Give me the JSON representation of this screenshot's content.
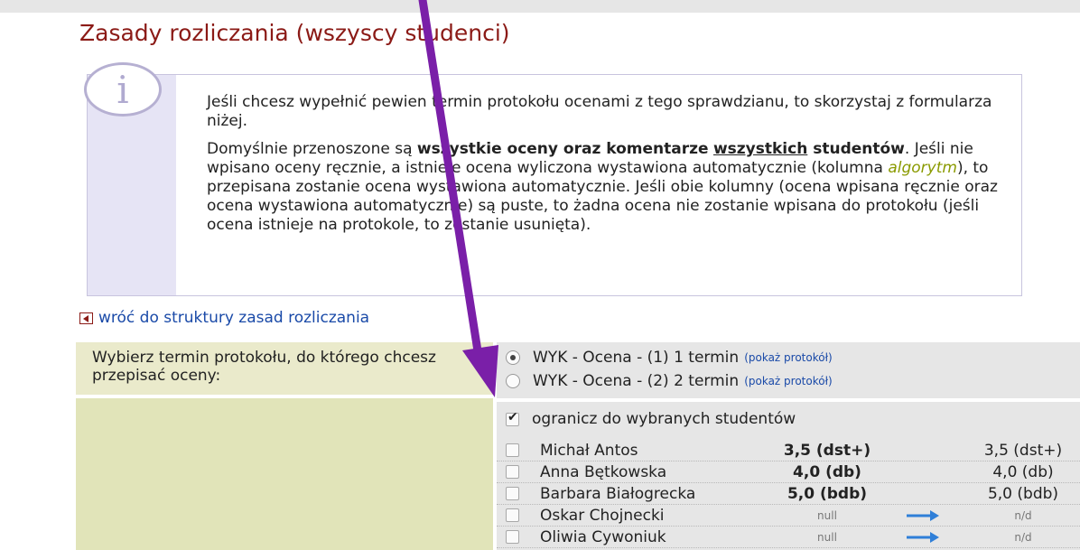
{
  "page": {
    "title": "Zasady rozliczania (wszyscy studenci)",
    "back_link": "wróć do struktury zasad rozliczania"
  },
  "info": {
    "icon": "info-icon",
    "p1": "Jeśli chcesz wypełnić pewien termin protokołu ocenami z tego sprawdzianu, to skorzystaj z formularza niżej.",
    "p2_a": "Domyślnie przenoszone są ",
    "p2_b": "wszystkie oceny oraz komentarze",
    "p2_c": "wszystkich",
    "p2_d": " studentów",
    "p2_e": ". Jeśli nie wpisano oceny ręcznie, a istnieje ocena wyliczona wystawiona automatycznie (kolumna ",
    "p2_f": "algorytm",
    "p2_g": "), to przepisana zostanie ocena wystawiona automatycznie. Jeśli obie kolumny (ocena wpisana ręcznie oraz ocena wystawiona automatycznie) są puste, to żadna ocena nie zostanie wpisana do protokołu (jeśli ocena istnieje na protokole, to zostanie usunięta)."
  },
  "form": {
    "prompt": "Wybierz termin protokołu, do którego chcesz przepisać oceny:",
    "terms": [
      {
        "label": "WYK - Ocena - (1) 1 termin",
        "link": "(pokaż protokół)",
        "selected": true
      },
      {
        "label": "WYK - Ocena - (2) 2 termin",
        "link": "(pokaż protokół)",
        "selected": false
      }
    ],
    "restrict_label": "ogranicz do wybranych studentów",
    "restrict_checked": true,
    "students": [
      {
        "name": "Michał Antos",
        "grade": "3,5 (dst+)",
        "final": "3,5 (dst+)",
        "arrow": false
      },
      {
        "name": "Anna Bętkowska",
        "grade": "4,0 (db)",
        "final": "4,0 (db)",
        "arrow": false
      },
      {
        "name": "Barbara Białogrecka",
        "grade": "5,0 (bdb)",
        "final": "5,0 (bdb)",
        "arrow": false
      },
      {
        "name": "Oskar Chojnecki",
        "grade": "null",
        "final": "n/d",
        "arrow": true
      },
      {
        "name": "Oliwia Cywoniuk",
        "grade": "null",
        "final": "n/d",
        "arrow": true
      }
    ]
  },
  "colors": {
    "title": "#8b1a16",
    "link": "#1a4aa8",
    "annotation_arrow": "#7a1fa8",
    "row_arrow": "#2f7fd8"
  }
}
